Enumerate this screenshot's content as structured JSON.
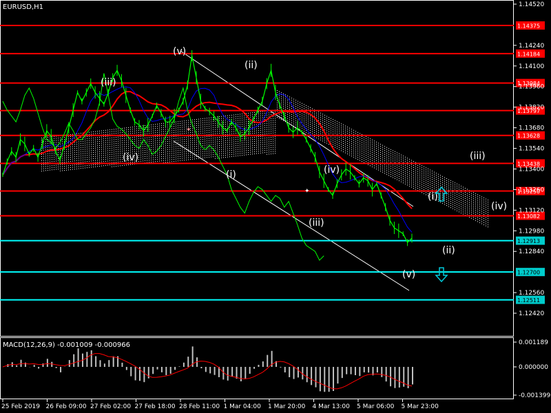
{
  "symbol": "EURUSD,H1",
  "macd_label": "MACD(12,26,9) -0.001009 -0.000966",
  "colors": {
    "background": "#000000",
    "price": "#00ff00",
    "red_level": "#ff0000",
    "cyan_level": "#00ffff",
    "badge_red": "#ff0000",
    "badge_cyan": "#00cccc",
    "blue_line": "#0000ff",
    "red_ma": "#ff0000",
    "cloud": "#ffffff",
    "macd_hist": "#c0c0c0",
    "macd_signal": "#ff0000",
    "channel": "#ffffff",
    "arrow": "#00ccdd"
  },
  "price_axis": {
    "ticks": [
      "1.14520",
      "1.14240",
      "1.14100",
      "1.13960",
      "1.13820",
      "1.13680",
      "1.13540",
      "1.13400",
      "1.13260",
      "1.13120",
      "1.12980",
      "1.12840",
      "1.12560",
      "1.12420"
    ],
    "ylim": [
      1.1235,
      1.1452
    ]
  },
  "price_levels": [
    {
      "label": "1.14375",
      "value": 1.14375,
      "kind": "red"
    },
    {
      "label": "1.14184",
      "value": 1.14184,
      "kind": "red"
    },
    {
      "label": "1.13984",
      "value": 1.13984,
      "kind": "red"
    },
    {
      "label": "1.13797",
      "value": 1.13797,
      "kind": "red"
    },
    {
      "label": "1.13628",
      "value": 1.13628,
      "kind": "red"
    },
    {
      "label": "1.13438",
      "value": 1.13438,
      "kind": "red"
    },
    {
      "label": "1.13250",
      "value": 1.1325,
      "kind": "red"
    },
    {
      "label": "1.13082",
      "value": 1.13082,
      "kind": "red"
    },
    {
      "label": "1.12913",
      "value": 1.12913,
      "kind": "cyan"
    },
    {
      "label": "1.12700",
      "value": 1.127,
      "kind": "cyan"
    },
    {
      "label": "1.12511",
      "value": 1.12511,
      "kind": "cyan"
    }
  ],
  "macd_axis": [
    "0.001189",
    "0.000000",
    "-0.001399"
  ],
  "time_axis": [
    "25 Feb 2019",
    "26 Feb 09:00",
    "27 Feb 02:00",
    "27 Feb 18:00",
    "28 Feb 11:00",
    "1 Mar 04:00",
    "1 Mar 20:00",
    "4 Mar 13:00",
    "5 Mar 06:00",
    "5 Mar 23:00"
  ],
  "wave_labels": [
    "(v)",
    "(ii)",
    "(iii)",
    "(iv)",
    "(i)",
    "(iv)",
    "(iii)",
    "(v)",
    "(iii)",
    "(i)",
    "(iv)",
    "(ii)"
  ],
  "price_series": [
    1.1336,
    1.1345,
    1.1352,
    1.1348,
    1.136,
    1.1357,
    1.135,
    1.1354,
    1.1348,
    1.1357,
    1.1366,
    1.1362,
    1.1352,
    1.1346,
    1.1356,
    1.1368,
    1.138,
    1.1392,
    1.1386,
    1.1392,
    1.1398,
    1.1392,
    1.1388,
    1.1384,
    1.1392,
    1.1402,
    1.1407,
    1.14,
    1.139,
    1.138,
    1.1372,
    1.137,
    1.1366,
    1.137,
    1.1376,
    1.1383,
    1.1378,
    1.1372,
    1.1372,
    1.1376,
    1.138,
    1.1386,
    1.1397,
    1.1417,
    1.1402,
    1.1386,
    1.1381,
    1.1379,
    1.1376,
    1.1372,
    1.1368,
    1.1366,
    1.1372,
    1.1368,
    1.1362,
    1.1364,
    1.1368,
    1.1374,
    1.138,
    1.1386,
    1.1398,
    1.1407,
    1.1392,
    1.1383,
    1.1376,
    1.1368,
    1.1365,
    1.1368,
    1.1365,
    1.136,
    1.1354,
    1.1348,
    1.1338,
    1.1332,
    1.1326,
    1.1322,
    1.133,
    1.1336,
    1.134,
    1.1338,
    1.1334,
    1.133,
    1.1334,
    1.1332,
    1.1326,
    1.133,
    1.1322,
    1.1314,
    1.1305,
    1.13,
    1.1298,
    1.1296,
    1.129,
    1.1293
  ]
}
